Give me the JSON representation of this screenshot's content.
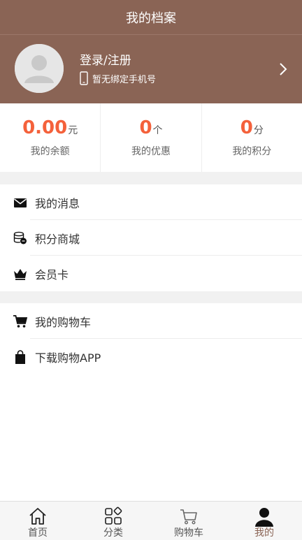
{
  "header": {
    "title": "我的档案"
  },
  "profile": {
    "login_label": "登录/注册",
    "phone_label": "暂无绑定手机号"
  },
  "stats": [
    {
      "value": "0.00",
      "unit": "元",
      "label": "我的余额"
    },
    {
      "value": "0",
      "unit": "个",
      "label": "我的优惠"
    },
    {
      "value": "0",
      "unit": "分",
      "label": "我的积分"
    }
  ],
  "menu_group_1": [
    {
      "label": "我的消息",
      "icon": "mail-icon"
    },
    {
      "label": "积分商城",
      "icon": "coins-icon"
    },
    {
      "label": "会员卡",
      "icon": "crown-icon"
    }
  ],
  "menu_group_2": [
    {
      "label": "我的购物车",
      "icon": "cart-icon"
    },
    {
      "label": "下载购物APP",
      "icon": "bag-icon"
    }
  ],
  "tabbar": [
    {
      "label": "首页",
      "icon": "home-icon"
    },
    {
      "label": "分类",
      "icon": "grid-icon"
    },
    {
      "label": "购物车",
      "icon": "cart-icon"
    },
    {
      "label": "我的",
      "icon": "user-icon",
      "active": true
    }
  ],
  "colors": {
    "brand": "#8a6455",
    "accent": "#f4613b",
    "background_gap": "#f1f1f1"
  }
}
